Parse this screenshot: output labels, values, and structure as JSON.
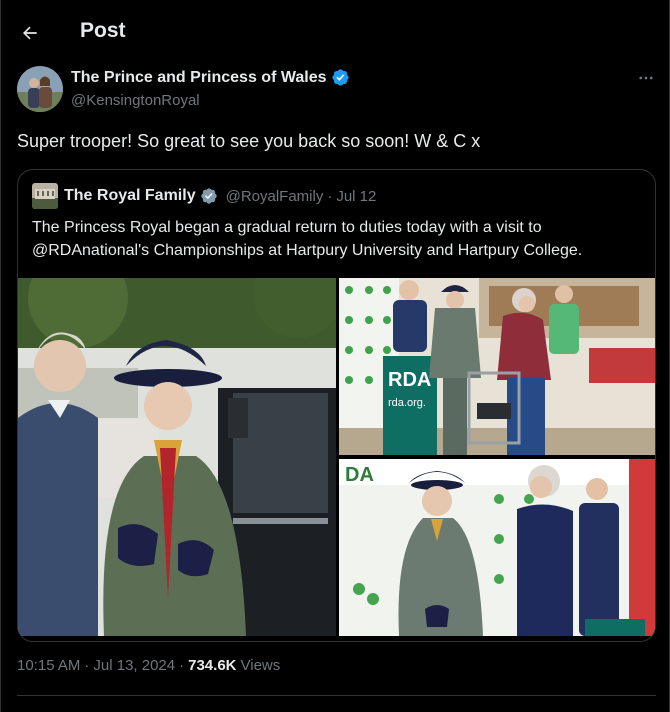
{
  "header": {
    "title": "Post",
    "back_icon": "arrow-left-icon"
  },
  "author": {
    "name": "The Prince and Princess of Wales",
    "handle": "@KensingtonRoyal",
    "verified_icon": "verified-badge-icon",
    "verified_color": "#1d9bf0"
  },
  "tweet": {
    "text": "Super trooper! So great to see you back so soon! W & C x"
  },
  "quote": {
    "name": "The Royal Family",
    "handle": "@RoyalFamily",
    "separator": "·",
    "date": "Jul 12",
    "verified_icon": "verified-badge-gray-icon",
    "text": "The Princess Royal began a gradual return to duties today with a visit to @RDAnational's Championships at Hartpury University and Hartpury College.",
    "images": {
      "photo2_banner_text": "RDA",
      "photo2_banner_url": "rda.org.",
      "photo3_banner_text": "DA"
    }
  },
  "meta": {
    "time": "10:15 AM",
    "separator": "·",
    "date": "Jul 13, 2024",
    "separator2": "·",
    "views": "734.6K",
    "views_label": "Views"
  },
  "colors": {
    "background": "#000000",
    "text_primary": "#e7e9ea",
    "text_secondary": "#71767b",
    "border": "#2f3336",
    "accent": "#1d9bf0"
  }
}
